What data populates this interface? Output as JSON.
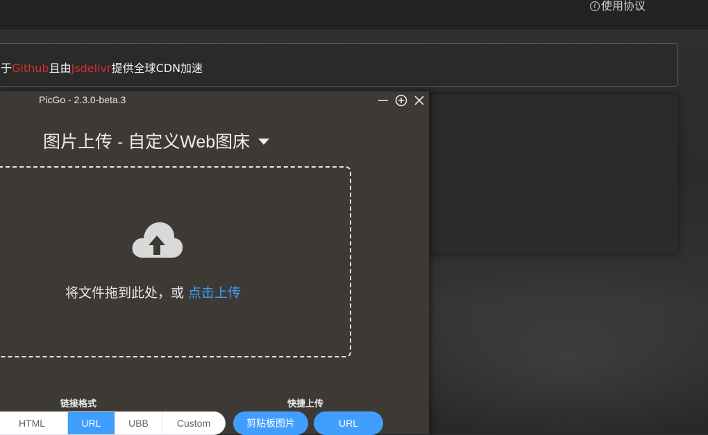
{
  "background": {
    "header": {
      "terms_label": "使用协议"
    },
    "notice": {
      "prefix": "于",
      "github": "Github",
      "mid": "且由",
      "jsdelivr": "Jsdelivr",
      "suffix": "提供全球CDN加速"
    }
  },
  "window": {
    "title": "PicGo - 2.3.0-beta.3",
    "controls": {
      "minimize": "minimize-icon",
      "pin": "add-circle-icon",
      "close": "close-icon"
    }
  },
  "uploader": {
    "title": "图片上传 - 自定义Web图床",
    "drop_text": "将文件拖到此处，或 ",
    "click_upload": "点击上传"
  },
  "link_format": {
    "label": "链接格式",
    "options": [
      "HTML",
      "URL",
      "UBB",
      "Custom"
    ],
    "selected": "URL"
  },
  "quick_upload": {
    "label": "快捷上传",
    "clipboard_label": "剪贴板图片",
    "url_label": "URL"
  },
  "colors": {
    "accent": "#409eff",
    "window_bg": "#3d3a36",
    "link_red": "#e02a2a"
  }
}
